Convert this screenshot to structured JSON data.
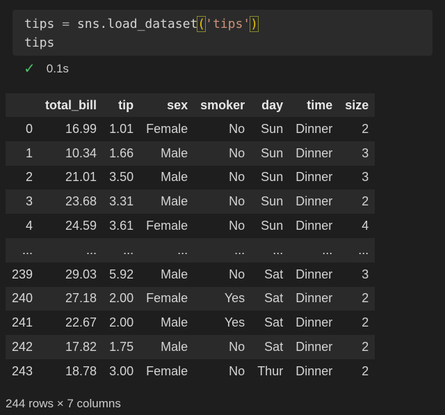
{
  "code_cell": {
    "line1": {
      "var": "tips",
      "op": "=",
      "call": "sns.load_dataset",
      "open_paren": "(",
      "arg": "'tips'",
      "close_paren": ")"
    },
    "line2": "tips",
    "status": {
      "icon": "check-icon",
      "time": "0.1s"
    }
  },
  "dataframe": {
    "columns": [
      "",
      "total_bill",
      "tip",
      "sex",
      "smoker",
      "day",
      "time",
      "size"
    ],
    "rows": [
      [
        "0",
        "16.99",
        "1.01",
        "Female",
        "No",
        "Sun",
        "Dinner",
        "2"
      ],
      [
        "1",
        "10.34",
        "1.66",
        "Male",
        "No",
        "Sun",
        "Dinner",
        "3"
      ],
      [
        "2",
        "21.01",
        "3.50",
        "Male",
        "No",
        "Sun",
        "Dinner",
        "3"
      ],
      [
        "3",
        "23.68",
        "3.31",
        "Male",
        "No",
        "Sun",
        "Dinner",
        "2"
      ],
      [
        "4",
        "24.59",
        "3.61",
        "Female",
        "No",
        "Sun",
        "Dinner",
        "4"
      ],
      [
        "...",
        "...",
        "...",
        "...",
        "...",
        "...",
        "...",
        "..."
      ],
      [
        "239",
        "29.03",
        "5.92",
        "Male",
        "No",
        "Sat",
        "Dinner",
        "3"
      ],
      [
        "240",
        "27.18",
        "2.00",
        "Female",
        "Yes",
        "Sat",
        "Dinner",
        "2"
      ],
      [
        "241",
        "22.67",
        "2.00",
        "Male",
        "Yes",
        "Sat",
        "Dinner",
        "2"
      ],
      [
        "242",
        "17.82",
        "1.75",
        "Male",
        "No",
        "Sat",
        "Dinner",
        "2"
      ],
      [
        "243",
        "18.78",
        "3.00",
        "Female",
        "No",
        "Thur",
        "Dinner",
        "2"
      ]
    ],
    "shape_text": "244 rows × 7 columns"
  },
  "colors": {
    "background": "#1e1e1e",
    "code_background": "#2b2b2b",
    "string": "#ce9178",
    "bracket_highlight": "#e8c400",
    "success": "#4ec06a",
    "stripe": "#2a2a2a"
  }
}
